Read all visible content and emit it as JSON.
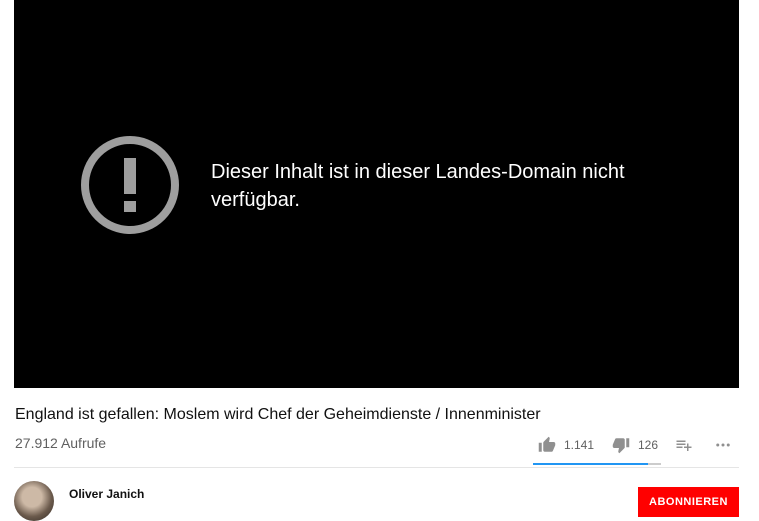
{
  "player": {
    "error_message": "Dieser Inhalt ist in dieser Landes-Domain nicht verfügbar.",
    "icon": "alert-circle-icon"
  },
  "video": {
    "title": "England ist gefallen: Moslem wird Chef der Geheimdienste / Innenminister",
    "views": "27.912 Aufrufe",
    "likes": "1.141",
    "dislikes": "126",
    "like_ratio": 0.9
  },
  "channel": {
    "name": "Oliver Janich",
    "subscribe_label": "ABONNIEREN"
  },
  "colors": {
    "player_bg": "#000000",
    "accent_blue": "#2196f3",
    "subscribe_red": "#ff0000"
  }
}
